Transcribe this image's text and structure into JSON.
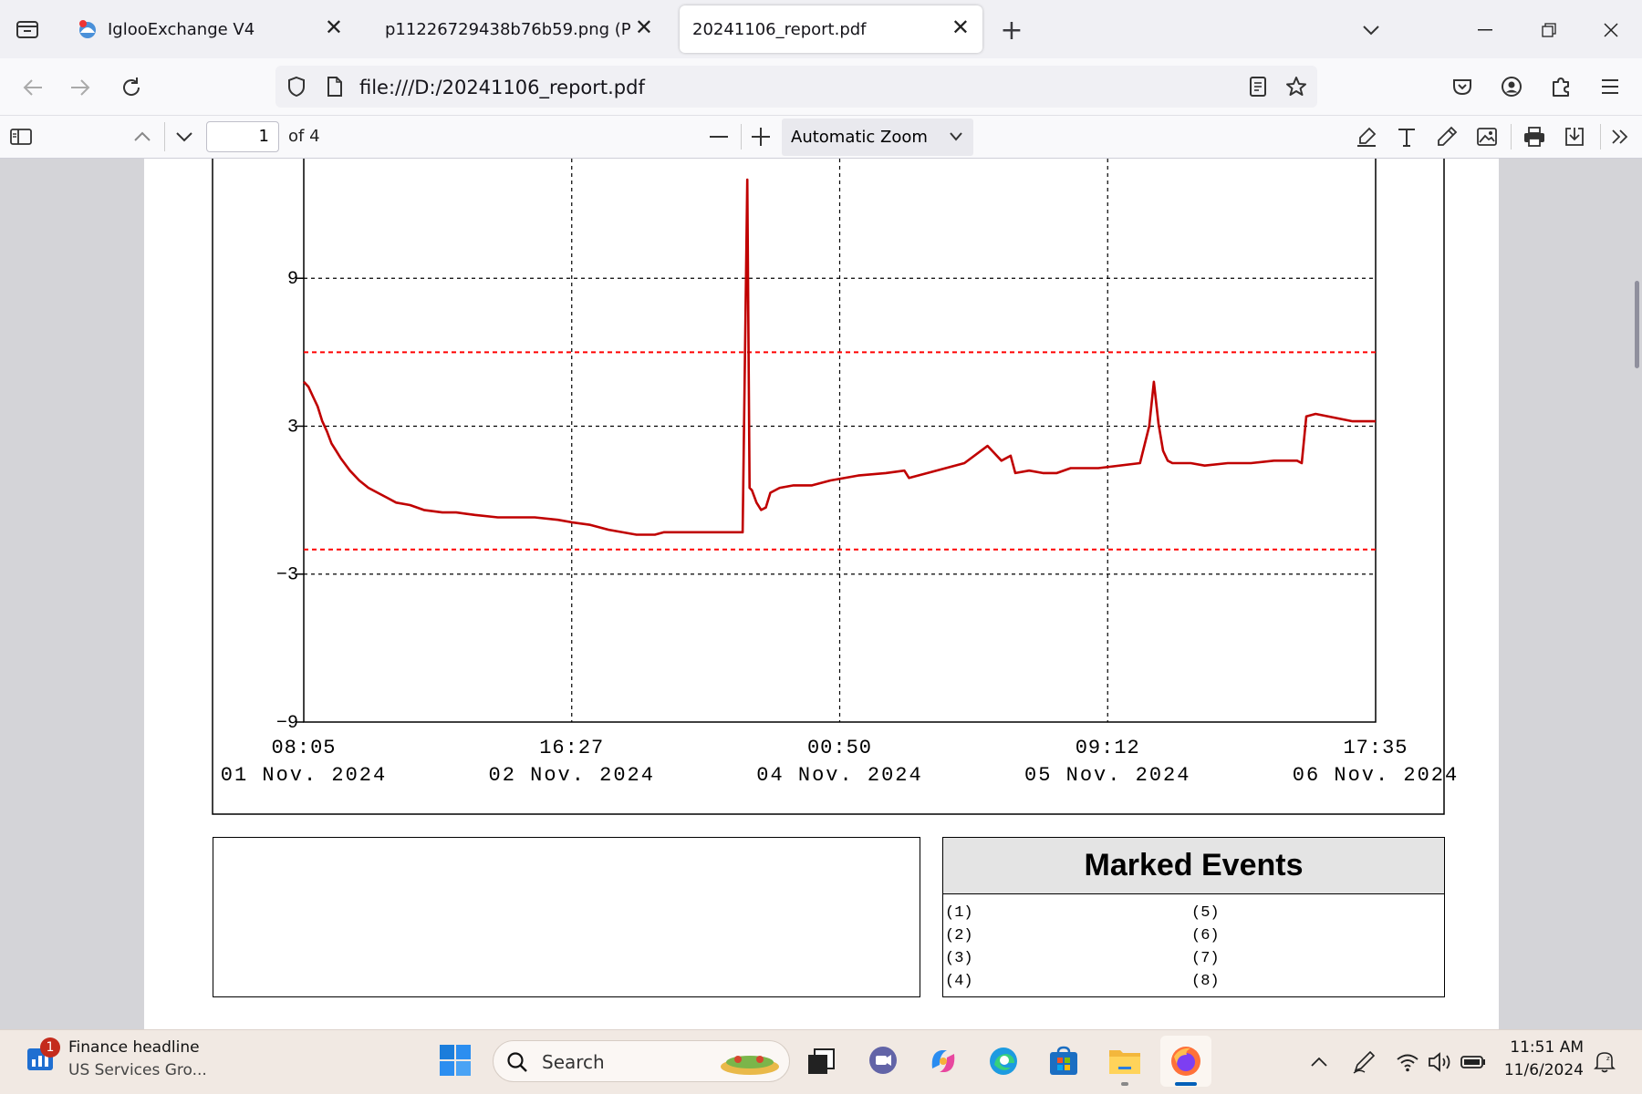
{
  "browser": {
    "tabs": [
      {
        "title": "IglooExchange V4"
      },
      {
        "title": "p11226729438b76b59.png (PNG Im"
      },
      {
        "title": "20241106_report.pdf",
        "active": true
      }
    ],
    "url": "file:///D:/20241106_report.pdf"
  },
  "pdf_toolbar": {
    "page_number": "1",
    "page_total": "of 4",
    "zoom": "Automatic Zoom"
  },
  "chart_data": {
    "type": "line",
    "y_ticks": [
      "9",
      "3",
      "−3",
      "−9"
    ],
    "ylim": [
      -9,
      14
    ],
    "x_ticks": [
      {
        "time": "08:05",
        "date": "01 Nov. 2024"
      },
      {
        "time": "16:27",
        "date": "02 Nov. 2024"
      },
      {
        "time": "00:50",
        "date": "04 Nov. 2024"
      },
      {
        "time": "09:12",
        "date": "05 Nov. 2024"
      },
      {
        "time": "17:35",
        "date": "06 Nov. 2024"
      }
    ],
    "x_range_hours": [
      0,
      129.5
    ],
    "thresholds": [
      6,
      -2
    ],
    "grid": true,
    "colors": {
      "series": "#c00000",
      "threshold": "#ff0000"
    },
    "series": [
      {
        "x": [
          0,
          1,
          2,
          3,
          4,
          5,
          6,
          7,
          8,
          10,
          12,
          14,
          16,
          18,
          20,
          23,
          26,
          30,
          33,
          37,
          42,
          50,
          55,
          58,
          62,
          66,
          72,
          76,
          78,
          82,
          86,
          90,
          94,
          95,
          96,
          96.5,
          97,
          98,
          99,
          100,
          101,
          103,
          106,
          110,
          114,
          120,
          126,
          130,
          131,
          135,
          143,
          148,
          151,
          153,
          154,
          157,
          160,
          163,
          166,
          172,
          181,
          183,
          184,
          185,
          186,
          187,
          188,
          190,
          192,
          195,
          200,
          205,
          210,
          215,
          216,
          217,
          219,
          227,
          232
        ],
        "y": [
          4.8,
          4.6,
          4.2,
          3.8,
          3.2,
          2.8,
          2.3,
          2.0,
          1.7,
          1.2,
          0.8,
          0.5,
          0.3,
          0.1,
          -0.1,
          -0.2,
          -0.4,
          -0.5,
          -0.5,
          -0.6,
          -0.7,
          -0.7,
          -0.8,
          -0.9,
          -1.0,
          -1.2,
          -1.4,
          -1.4,
          -1.3,
          -1.3,
          -1.3,
          -1.3,
          -1.3,
          -1.3,
          13.0,
          0.5,
          0.4,
          -0.1,
          -0.4,
          -0.3,
          0.3,
          0.5,
          0.6,
          0.6,
          0.8,
          1.0,
          1.1,
          1.2,
          0.9,
          1.1,
          1.5,
          2.2,
          1.6,
          1.8,
          1.1,
          1.2,
          1.1,
          1.1,
          1.3,
          1.3,
          1.5,
          3.0,
          4.8,
          3.1,
          2.0,
          1.6,
          1.5,
          1.5,
          1.5,
          1.4,
          1.5,
          1.5,
          1.6,
          1.6,
          1.5,
          3.4,
          3.5,
          3.2,
          3.2
        ],
        "x_scale": 0.5582
      }
    ]
  },
  "marked_events": {
    "title": "Marked Events",
    "col1": [
      "(1)",
      "(2)",
      "(3)",
      "(4)"
    ],
    "col2": [
      "(5)",
      "(6)",
      "(7)",
      "(8)"
    ]
  },
  "taskbar": {
    "widget_badge": "1",
    "widget_title": "Finance headline",
    "widget_subtitle": "US Services Gro...",
    "search_label": "Search",
    "time": "11:51 AM",
    "date": "11/6/2024"
  }
}
